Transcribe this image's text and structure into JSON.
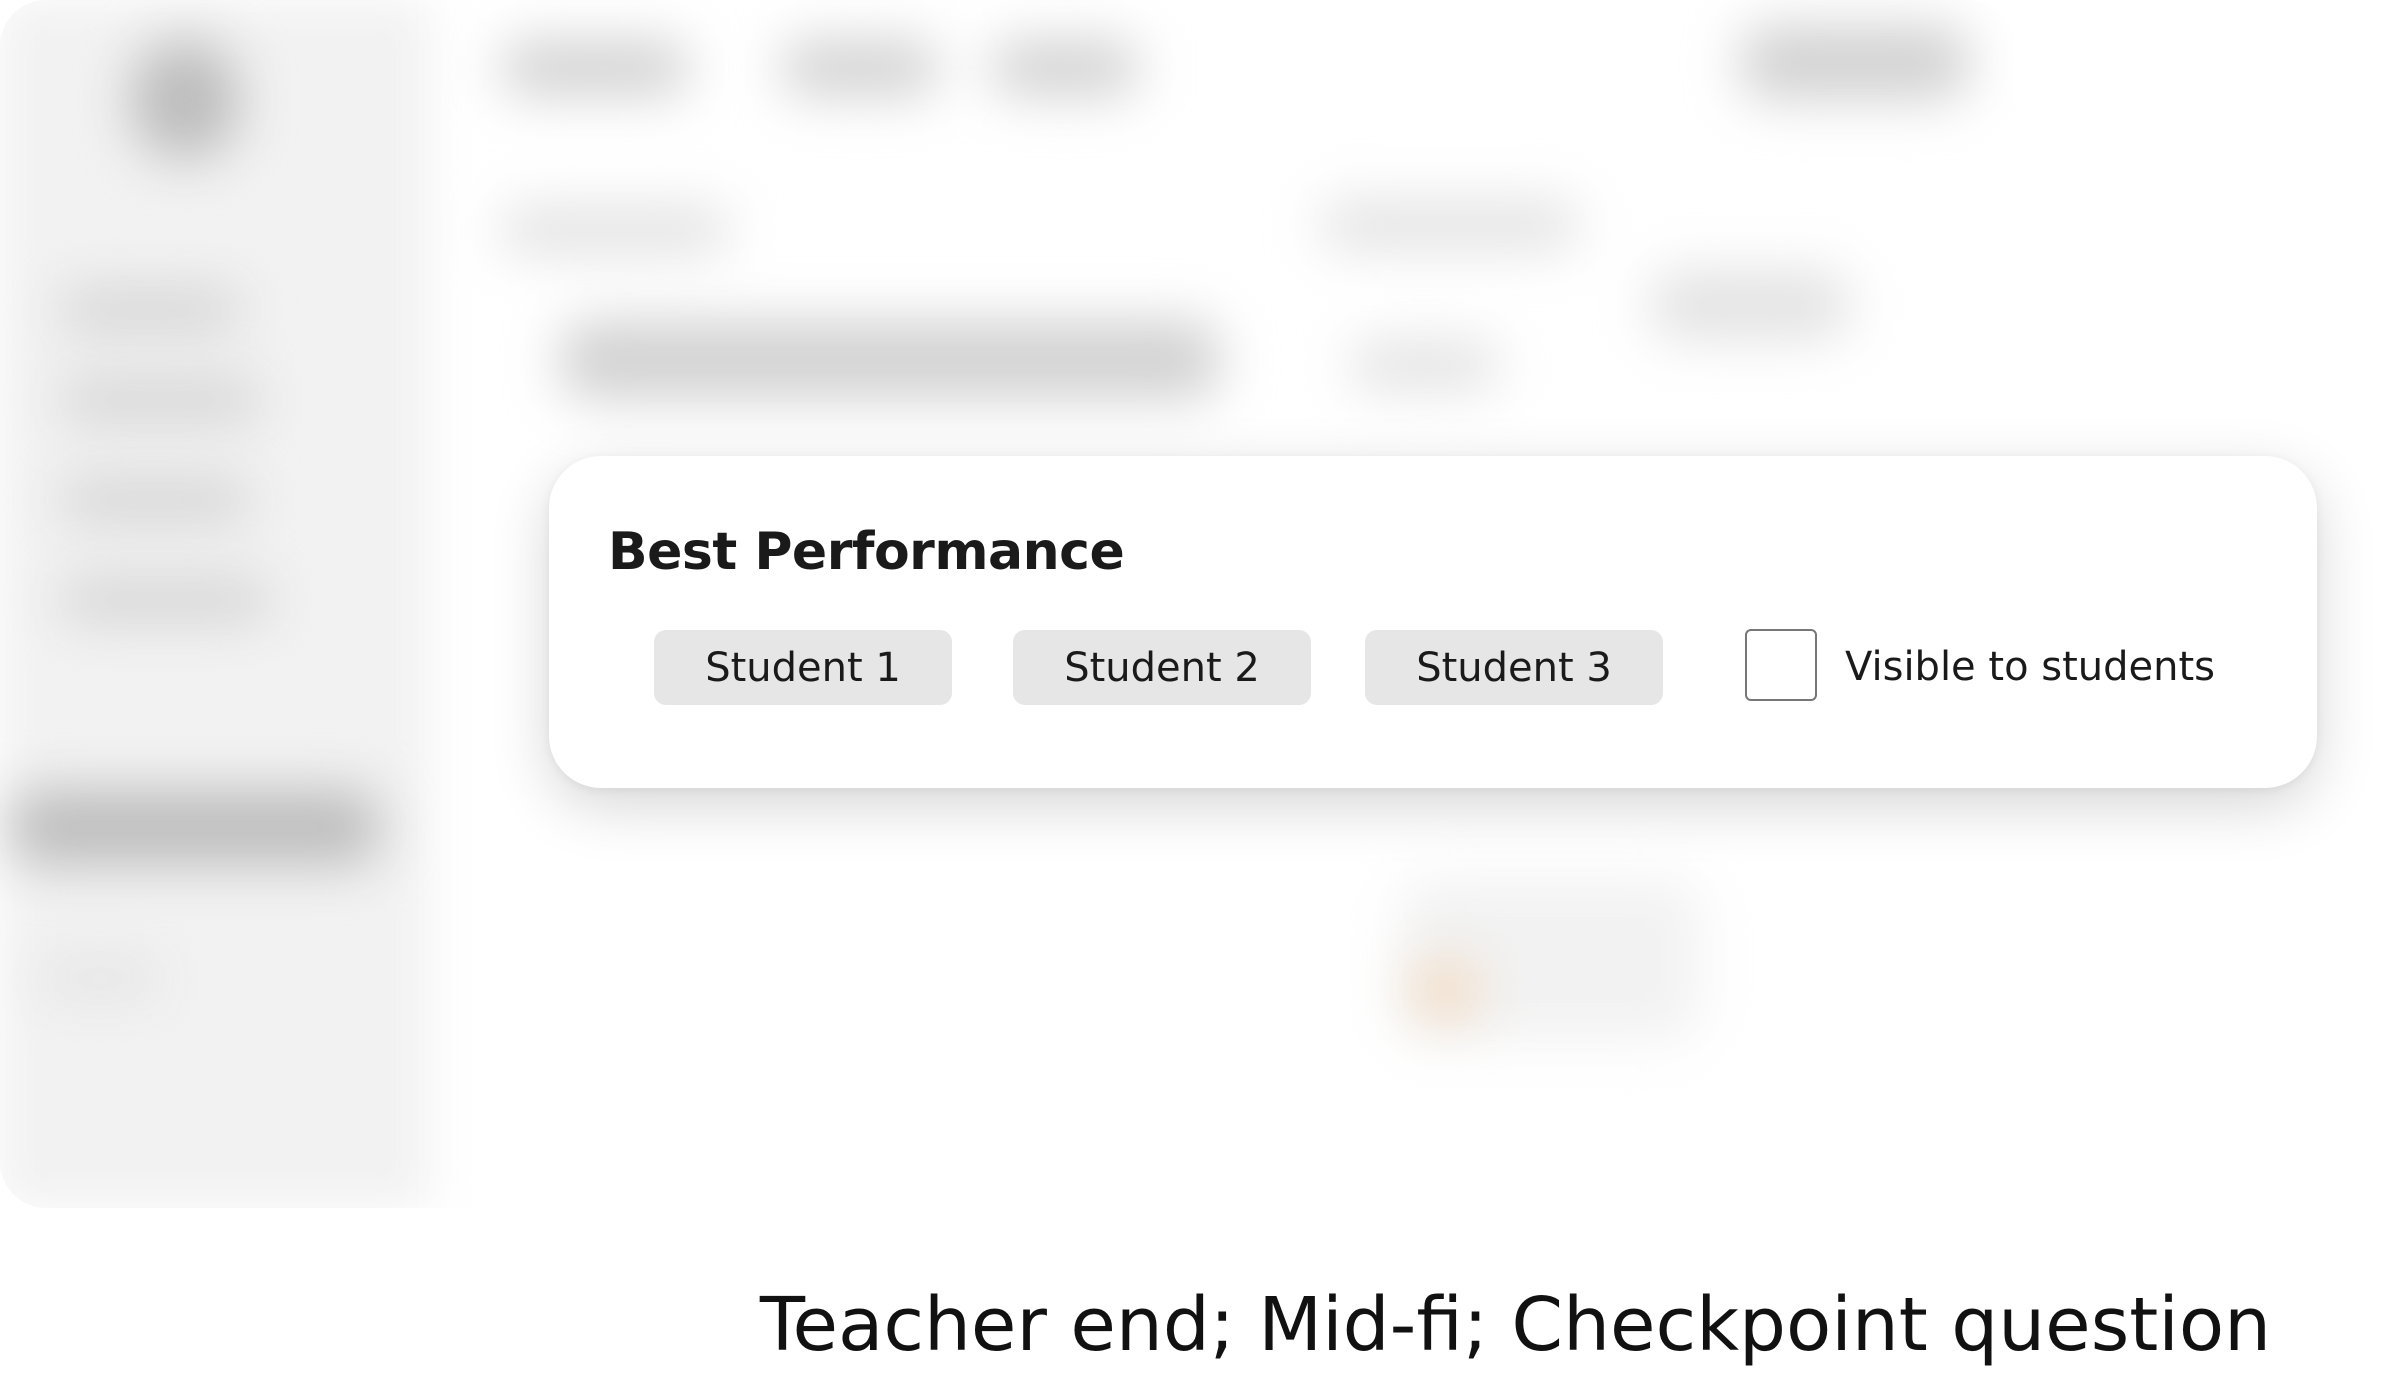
{
  "modal": {
    "title": "Best Performance",
    "students": [
      {
        "label": "Student 1"
      },
      {
        "label": "Student 2"
      },
      {
        "label": "Student 3"
      }
    ],
    "visibility_checkbox": {
      "label": "Visible to students",
      "checked": false
    }
  },
  "caption": "Teacher end; Mid-fi; Checkpoint question"
}
